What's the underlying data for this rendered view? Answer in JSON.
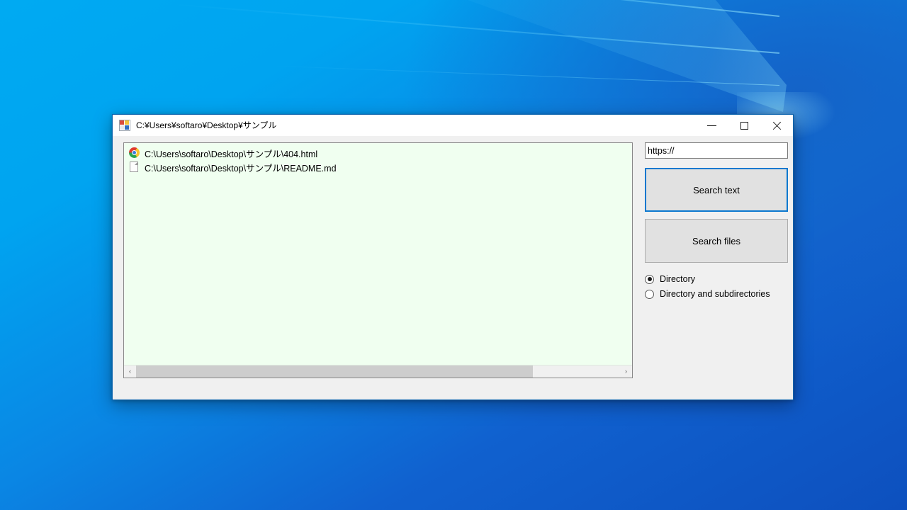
{
  "window": {
    "title": "C:¥Users¥softaro¥Desktop¥サンプル",
    "icon": "windows-forms-app-icon",
    "controls": {
      "minimize": "minimize-icon",
      "maximize": "maximize-icon",
      "close": "close-icon"
    }
  },
  "results": {
    "items": [
      {
        "icon": "chrome-icon",
        "path": "C:\\Users\\softaro\\Desktop\\サンプル\\404.html"
      },
      {
        "icon": "blank-document-icon",
        "path": "C:\\Users\\softaro\\Desktop\\サンプル\\README.md"
      }
    ],
    "background_color": "#f0fff0"
  },
  "scrollbar": {
    "left_arrow": "‹",
    "right_arrow": "›"
  },
  "side_panel": {
    "url_input": {
      "value": "https://",
      "placeholder": ""
    },
    "search_text_button": "Search text",
    "search_files_button": "Search files",
    "focus_color": "#0b78cf",
    "scope_options": [
      {
        "label": "Directory",
        "selected": true
      },
      {
        "label": "Directory and subdirectories",
        "selected": false
      }
    ]
  }
}
